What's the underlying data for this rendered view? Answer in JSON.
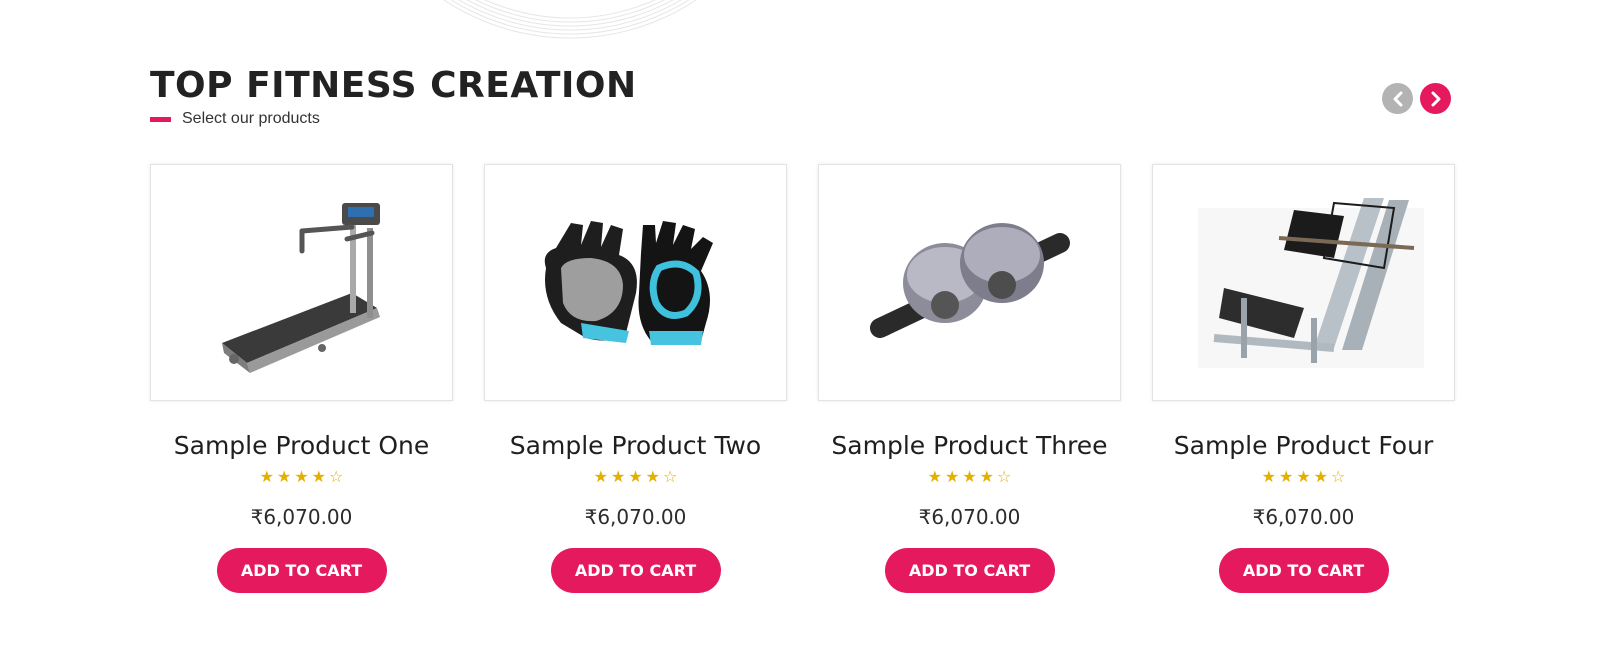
{
  "section": {
    "title": "TOP FITNESS CREATION",
    "subtitle": "Select our products"
  },
  "colors": {
    "accent": "#e5195e",
    "star": "#e4b000",
    "nav_prev_bg": "#b3b3b3"
  },
  "carousel": {
    "prev_icon": "chevron-left-icon",
    "next_icon": "chevron-right-icon"
  },
  "products": [
    {
      "name": "Sample Product One",
      "image": "treadmill",
      "rating": 4,
      "rating_max": 5,
      "price": "₹6,070.00",
      "cta": "ADD TO CART"
    },
    {
      "name": "Sample Product Two",
      "image": "fitness-gloves",
      "rating": 4,
      "rating_max": 5,
      "price": "₹6,070.00",
      "cta": "ADD TO CART"
    },
    {
      "name": "Sample Product Three",
      "image": "ab-roller",
      "rating": 4,
      "rating_max": 5,
      "price": "₹6,070.00",
      "cta": "ADD TO CART"
    },
    {
      "name": "Sample Product Four",
      "image": "leg-press-machine",
      "rating": 4,
      "rating_max": 5,
      "price": "₹6,070.00",
      "cta": "ADD TO CART"
    }
  ]
}
